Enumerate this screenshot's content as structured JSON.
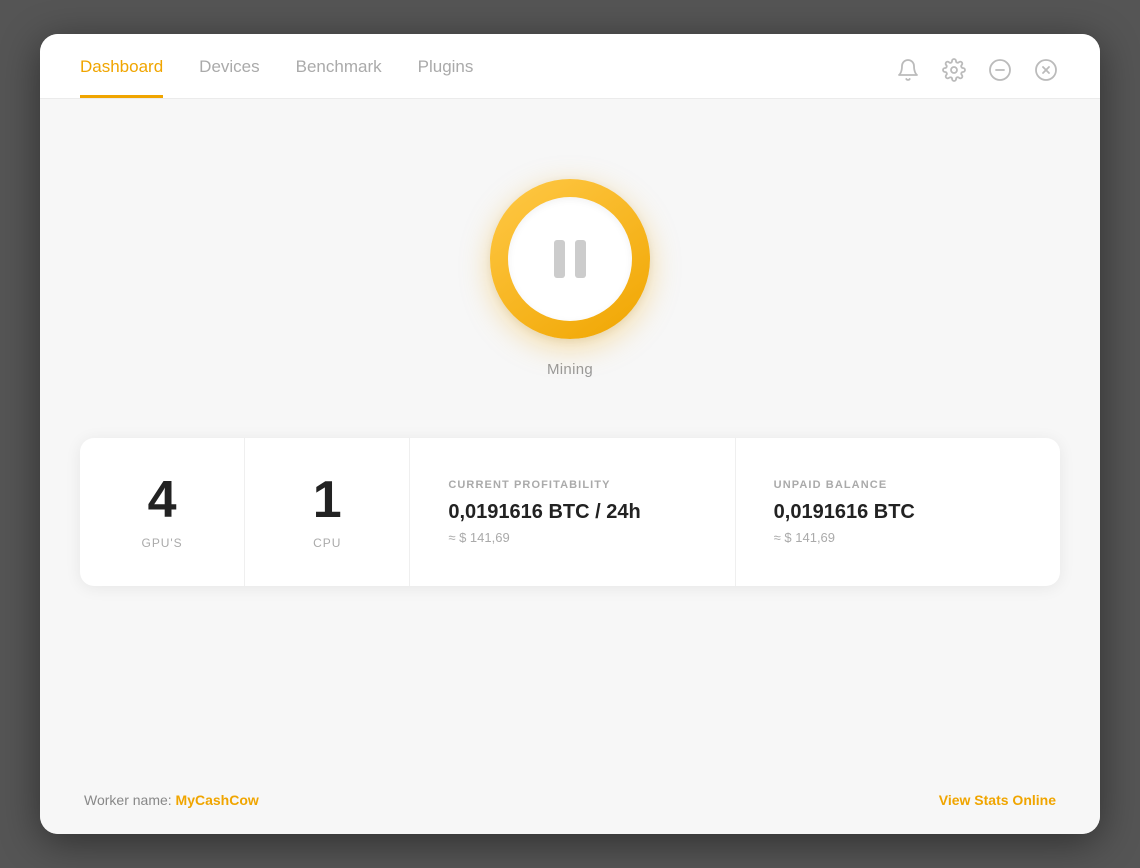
{
  "nav": {
    "tabs": [
      {
        "label": "Dashboard",
        "active": true
      },
      {
        "label": "Devices",
        "active": false
      },
      {
        "label": "Benchmark",
        "active": false
      },
      {
        "label": "Plugins",
        "active": false
      }
    ]
  },
  "header_icons": {
    "bell": "bell-icon",
    "settings": "gear-icon",
    "minimize": "minus-icon",
    "close": "close-icon"
  },
  "mining": {
    "status_label": "Mining"
  },
  "stats": {
    "gpu_count": "4",
    "gpu_label": "GPU'S",
    "cpu_count": "1",
    "cpu_label": "CPU",
    "profitability": {
      "title": "CURRENT PROFITABILITY",
      "value": "0,0191616 BTC / 24h",
      "usd": "≈ $ 141,69"
    },
    "balance": {
      "title": "UNPAID BALANCE",
      "value": "0,0191616 BTC",
      "usd": "≈ $ 141,69"
    }
  },
  "footer": {
    "worker_prefix": "Worker name: ",
    "worker_name": "MyCashCow",
    "view_stats": "View Stats Online"
  }
}
